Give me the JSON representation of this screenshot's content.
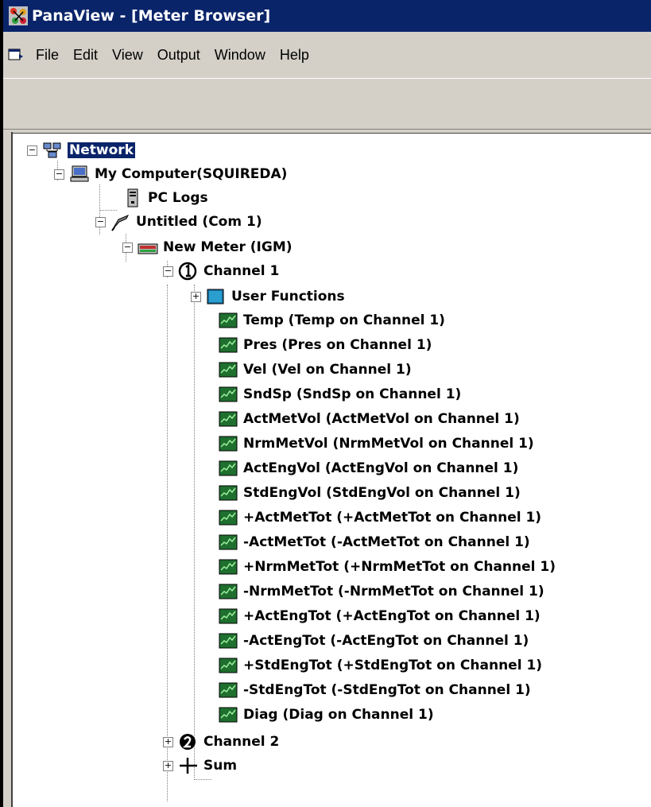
{
  "window": {
    "title": "PanaView - [Meter Browser]"
  },
  "menu": [
    "File",
    "Edit",
    "View",
    "Output",
    "Window",
    "Help"
  ],
  "tree": {
    "network": "Network",
    "computer": "My Computer(SQUIREDA)",
    "pc_logs": "PC Logs",
    "untitled": "Untitled (Com 1)",
    "meter": "New Meter (IGM)",
    "channel1": "Channel 1",
    "user_functions": "User Functions",
    "params": [
      "Temp (Temp on Channel 1)",
      "Pres (Pres on Channel 1)",
      "Vel (Vel on Channel 1)",
      "SndSp (SndSp on Channel 1)",
      "ActMetVol (ActMetVol on Channel 1)",
      "NrmMetVol (NrmMetVol on Channel 1)",
      "ActEngVol (ActEngVol on Channel 1)",
      "StdEngVol (StdEngVol on Channel 1)",
      "+ActMetTot (+ActMetTot on Channel 1)",
      "-ActMetTot (-ActMetTot on Channel 1)",
      "+NrmMetTot (+NrmMetTot on Channel 1)",
      "-NrmMetTot (-NrmMetTot on Channel 1)",
      "+ActEngTot (+ActEngTot on Channel 1)",
      "-ActEngTot (-ActEngTot on Channel 1)",
      "+StdEngTot (+StdEngTot on Channel 1)",
      "-StdEngTot (-StdEngTot on Channel 1)",
      "Diag (Diag on Channel 1)"
    ],
    "channel2": "Channel 2",
    "sum": "Sum"
  }
}
